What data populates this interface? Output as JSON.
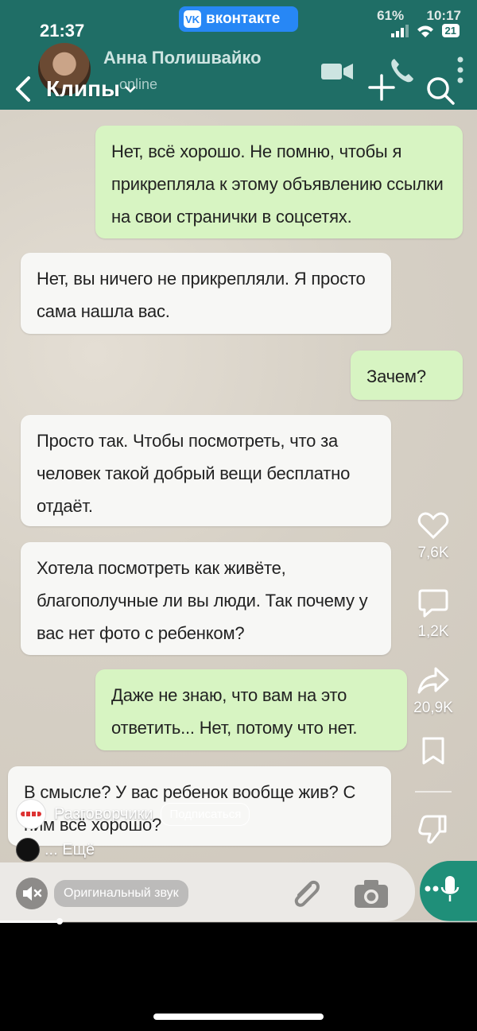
{
  "status_bar": {
    "time": "21:37",
    "battery": "21"
  },
  "video_status_bar": {
    "battery_percent": "61%",
    "time": "10:17"
  },
  "vk_badge": {
    "label": "вконтакте",
    "logo": "VK"
  },
  "whatsapp": {
    "contact_name": "Анна Полишвайко",
    "contact_status": "online"
  },
  "header": {
    "title": "Клипы"
  },
  "chat": [
    {
      "dir": "out",
      "text": "Нет, всё хорошо. Не помню, чтобы я прикрепляла к этому объявлению ссылки на свои странички в соцсетях."
    },
    {
      "dir": "in",
      "text": "Нет, вы ничего не прикрепляли. Я просто сама нашла вас."
    },
    {
      "dir": "out",
      "text": "Зачем?"
    },
    {
      "dir": "in",
      "text": "Просто так. Чтобы посмотреть, что за человек такой добрый вещи бесплатно отдаёт."
    },
    {
      "dir": "in",
      "text": "Хотела посмотреть как живёте, благополучные ли вы люди. Так почему у вас нет фото с ребенком?"
    },
    {
      "dir": "out",
      "text": "Даже не знаю, что вам на это ответить... Нет, потому что нет."
    },
    {
      "dir": "in",
      "text": "В смысле? У вас ребенок вообще жив? С ним всё хорошо?"
    }
  ],
  "actions": {
    "likes": "7,6K",
    "comments": "1,2K",
    "shares": "20,9K"
  },
  "author": {
    "name": "Разговорчики",
    "subscribe_label": "Подписаться",
    "more_label": "... Ещё"
  },
  "sound": {
    "label": "Оригинальный звук"
  },
  "progress": {
    "fraction": 0.125
  }
}
